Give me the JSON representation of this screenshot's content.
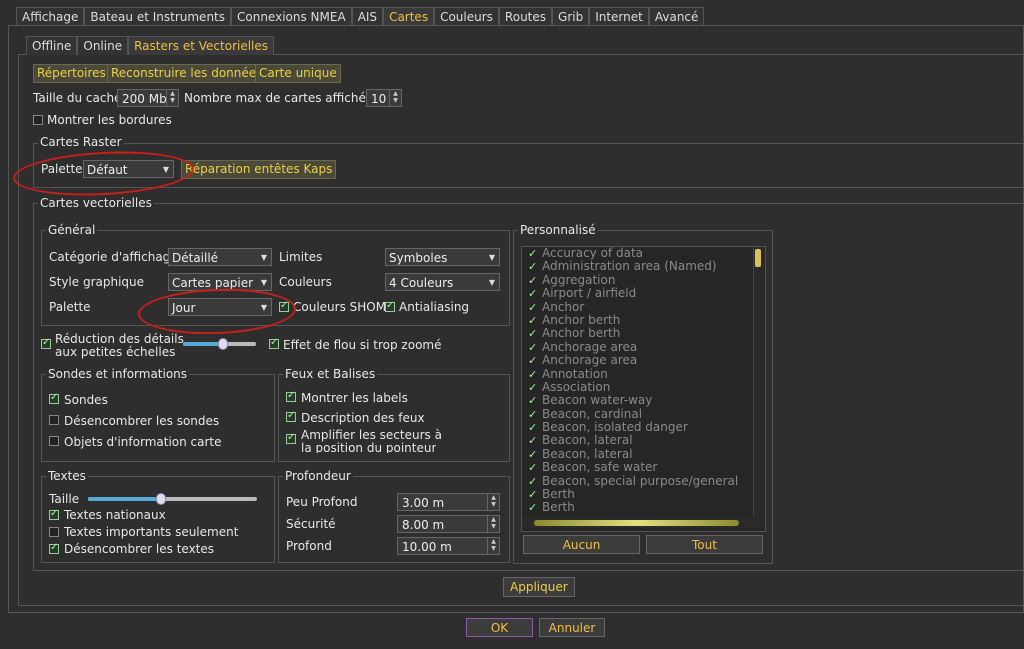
{
  "main_tabs": [
    "Affichage",
    "Bateau et Instruments",
    "Connexions NMEA",
    "AIS",
    "Cartes",
    "Couleurs",
    "Routes",
    "Grib",
    "Internet",
    "Avancé"
  ],
  "main_tab_active": "Cartes",
  "sub_tabs": [
    "Offline",
    "Online",
    "Rasters et Vectorielles"
  ],
  "sub_tab_active": "Rasters et Vectorielles",
  "toolbar": {
    "repertoires": "Répertoires",
    "reconstruire": "Reconstruire les données",
    "carte_unique": "Carte unique"
  },
  "cache": {
    "label": "Taille du cache",
    "value": "200 Mb",
    "max_label": "Nombre max de cartes affichées",
    "max_value": "10"
  },
  "borders": {
    "label": "Montrer les bordures",
    "checked": false
  },
  "raster": {
    "title": "Cartes Raster",
    "palette_label": "Palette",
    "palette_value": "Défaut",
    "repair_btn": "Réparation entêtes Kaps"
  },
  "vector": {
    "title": "Cartes vectorielles",
    "general": {
      "title": "Général",
      "cat_label": "Catégorie d'affichage",
      "cat_value": "Détaillé",
      "limits_label": "Limites",
      "limits_value": "Symboles",
      "style_label": "Style graphique",
      "style_value": "Cartes papier",
      "colors_label": "Couleurs",
      "colors_value": "4 Couleurs",
      "palette_label": "Palette",
      "palette_value": "Jour",
      "shom_label": "Couleurs SHOM",
      "antialias_label": "Antialiasing"
    },
    "reduction_label_1": "Réduction des détails",
    "reduction_label_2": "aux petites échelles",
    "reduction_level": 0.55,
    "blur_label": "Effet de flou si trop zoomé",
    "sondes": {
      "title": "Sondes et informations",
      "sondes": "Sondes",
      "desencombrer": "Désencombrer les sondes",
      "objets": "Objets d'information carte"
    },
    "feux": {
      "title": "Feux et Balises",
      "labels": "Montrer les labels",
      "description": "Description des feux",
      "amplifier_1": "Amplifier les secteurs à",
      "amplifier_2": "la position du pointeur"
    },
    "textes": {
      "title": "Textes",
      "taille": "Taille",
      "taille_level": 0.43,
      "nationaux": "Textes nationaux",
      "importants": "Textes importants seulement",
      "desencombrer": "Désencombrer les textes"
    },
    "profondeur": {
      "title": "Profondeur",
      "peu_label": "Peu Profond",
      "peu_value": "3.00 m",
      "securite_label": "Sécurité",
      "securite_value": "8.00 m",
      "profond_label": "Profond",
      "profond_value": "10.00 m"
    },
    "perso": {
      "title": "Personnalisé",
      "items": [
        "Accuracy of data",
        "Administration area (Named)",
        "Aggregation",
        "Airport / airfield",
        "Anchor",
        "Anchor berth",
        "Anchor berth",
        "Anchorage area",
        "Anchorage area",
        "Annotation",
        "Association",
        "Beacon water-way",
        "Beacon, cardinal",
        "Beacon, isolated danger",
        "Beacon, lateral",
        "Beacon, lateral",
        "Beacon, safe water",
        "Beacon, special purpose/general",
        "Berth",
        "Berth"
      ],
      "aucun": "Aucun",
      "tout": "Tout"
    }
  },
  "apply": "Appliquer",
  "ok": "OK",
  "cancel": "Annuler",
  "colors": {
    "accent": "#f0c040",
    "background": "#2e2e2e",
    "annotation_red": "#c8201a"
  }
}
